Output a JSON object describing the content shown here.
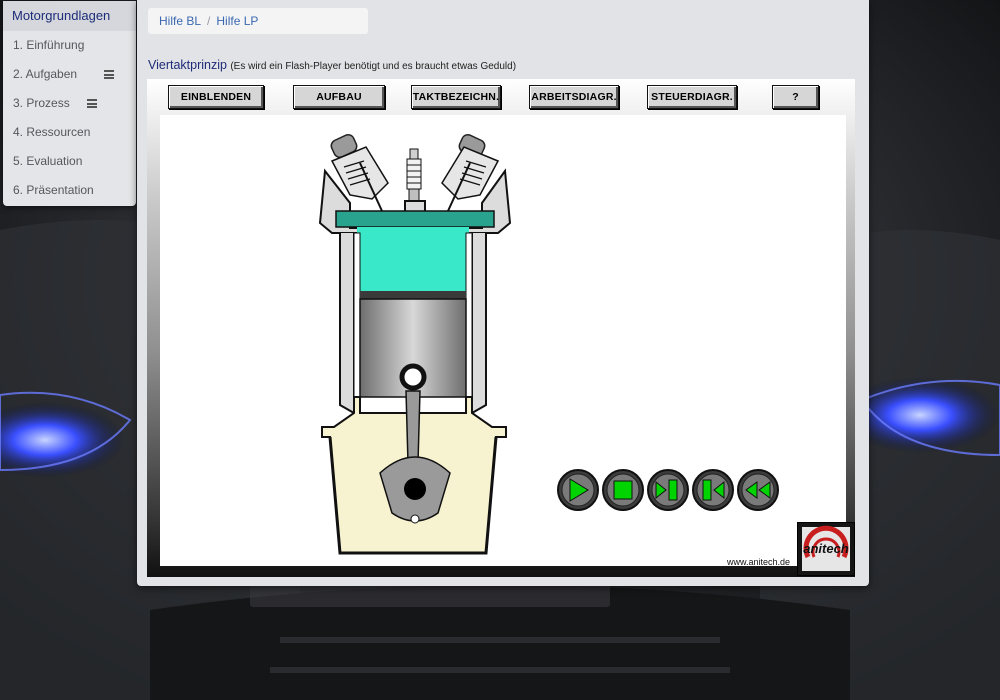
{
  "sidebar": {
    "title": "Motorgrundlagen",
    "items": [
      {
        "label": "1. Einführung",
        "has_menu": false
      },
      {
        "label": "2. Aufgaben",
        "has_menu": true
      },
      {
        "label": "3. Prozess",
        "has_menu": true
      },
      {
        "label": "4. Ressourcen",
        "has_menu": false
      },
      {
        "label": "5. Evaluation",
        "has_menu": false
      },
      {
        "label": "6. Präsentation",
        "has_menu": false
      }
    ]
  },
  "breadcrumb": {
    "link1": "Hilfe BL",
    "separator": "/",
    "link2": "Hilfe LP"
  },
  "page": {
    "title": "Viertaktprinzip",
    "note": "(Es wird ein Flash-Player benötigt und es braucht etwas Geduld)"
  },
  "toolbar": {
    "buttons": [
      "EINBLENDEN",
      "AUFBAU",
      "TAKTBEZEICHN.",
      "ARBEITSDIAGR.",
      "STEUERDIAGR.",
      "?"
    ]
  },
  "playback": {
    "controls": [
      "play-icon",
      "stop-icon",
      "step-forward-icon",
      "step-back-icon",
      "rewind-icon"
    ],
    "icon_color": "#00d400"
  },
  "branding": {
    "url": "www.anitech.de",
    "logo_text": "anitech",
    "logo_color": "#c81e1e"
  },
  "colors": {
    "accent": "#1d2c78",
    "link": "#3a68b0",
    "combustion": "#38e8c8",
    "crankcase": "#f7f3d0"
  }
}
